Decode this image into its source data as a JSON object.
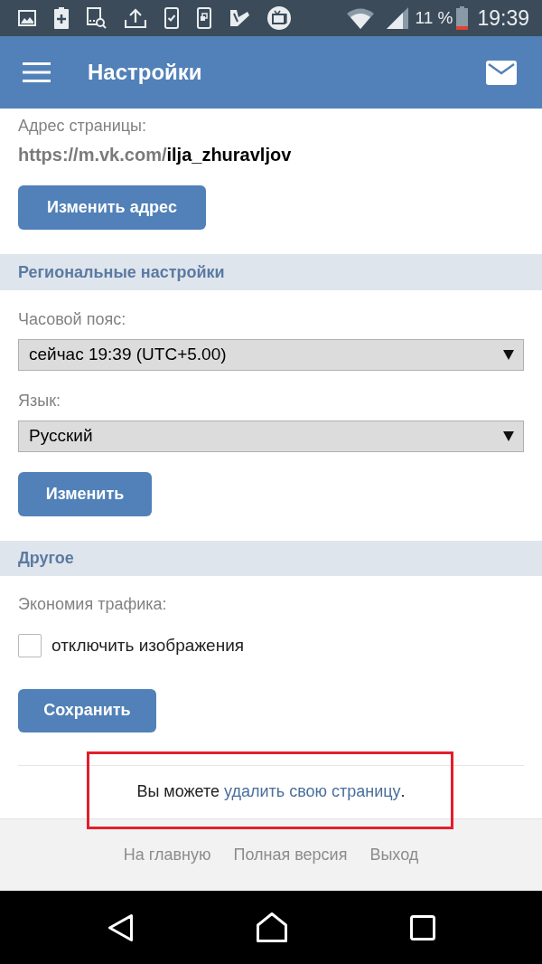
{
  "status_bar": {
    "battery_text": "11 %",
    "time": "19:39"
  },
  "header": {
    "title": "Настройки"
  },
  "page_address": {
    "label": "Адрес страницы:",
    "url_prefix": "https://m.vk.com/",
    "url_username": "ilja_zhuravljov",
    "button": "Изменить адрес"
  },
  "regional_section": {
    "title": "Региональные настройки",
    "selects": [
      {
        "label": "Часовой пояс:",
        "value": "сейчас 19:39 (UTC+5.00)"
      },
      {
        "label": "Язык:",
        "value": "Русский"
      }
    ],
    "button": "Изменить"
  },
  "other_section": {
    "title": "Другое",
    "label": "Экономия трафика:",
    "checkbox": {
      "label": "отключить изображения",
      "checked": false
    },
    "button": "Сохранить"
  },
  "delete_notice": {
    "text": "Вы можете ",
    "link": "удалить свою страницу",
    "after": ".",
    "highlighted": true
  },
  "footer_links": [
    "На главную",
    "Полная версия",
    "Выход"
  ]
}
